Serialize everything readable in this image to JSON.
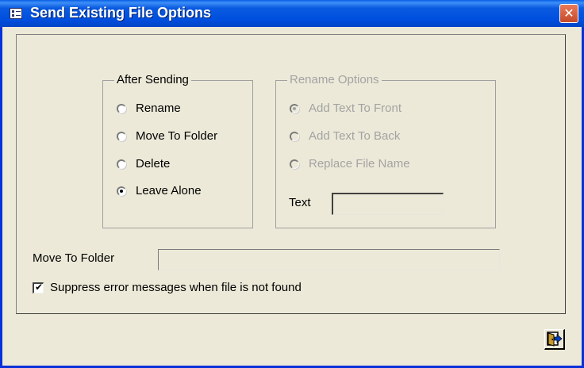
{
  "window": {
    "title": "Send Existing File Options",
    "close_glyph": "✕",
    "icon": "form-icon"
  },
  "after_sending": {
    "label": "After Sending",
    "options": [
      {
        "label": "Rename",
        "checked": false
      },
      {
        "label": "Move To Folder",
        "checked": false
      },
      {
        "label": "Delete",
        "checked": false
      },
      {
        "label": "Leave Alone",
        "checked": true
      }
    ]
  },
  "rename_options": {
    "label": "Rename Options",
    "enabled": false,
    "options": [
      {
        "label": "Add Text To Front",
        "checked": true
      },
      {
        "label": "Add Text To Back",
        "checked": false
      },
      {
        "label": "Replace File Name",
        "checked": false
      }
    ],
    "text_label": "Text",
    "text_value": ""
  },
  "move_to_folder": {
    "label": "Move To Folder",
    "value": ""
  },
  "suppress_errors": {
    "label": "Suppress error messages when file is not found",
    "checked": true,
    "checkmark": "✔"
  },
  "exit_button": {
    "icon": "exit-door-icon"
  },
  "colors": {
    "titlebar": "#0054e3",
    "window_bg": "#ece9d8",
    "close_button": "#d35a37",
    "disabled_text": "#a3a3a3"
  }
}
